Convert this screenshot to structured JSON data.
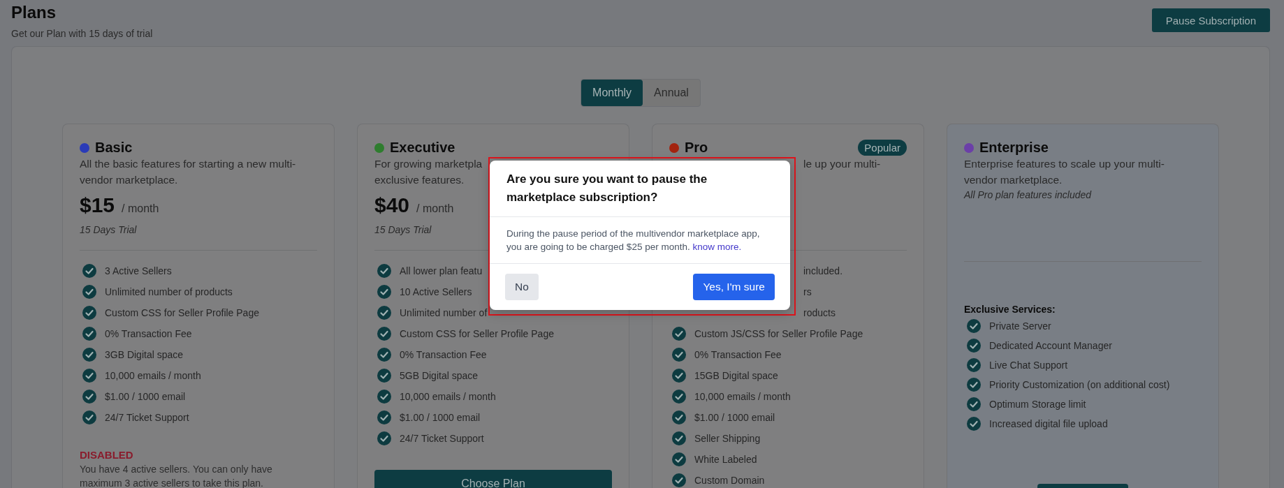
{
  "header": {
    "title": "Plans",
    "subtitle": "Get our Plan with 15 days of trial",
    "pause_button": "Pause Subscription"
  },
  "billing_toggle": [
    {
      "label": "Monthly",
      "selected": true
    },
    {
      "label": "Annual",
      "selected": false
    }
  ],
  "plans": [
    {
      "name": "Basic",
      "color": "#2a3bb8",
      "description_lines": [
        "All the basic features for starting a new multi-",
        "vendor marketplace."
      ],
      "price": "$15",
      "period": "/ month",
      "trial": "15 Days Trial",
      "features": [
        "3 Active Sellers",
        "Unlimited number of products",
        "Custom CSS for Seller Profile Page",
        "0% Transaction Fee",
        "3GB Digital space",
        "10,000 emails / month",
        "$1.00 / 1000 email",
        "24/7 Ticket Support"
      ],
      "notice": {
        "title": "DISABLED",
        "text": "You have 4 active sellers. You can only have maximum 3 active sellers to take this plan."
      }
    },
    {
      "name": "Executive",
      "color": "#2e7d2e",
      "description_lines": [
        "For growing marketpla",
        "exclusive features."
      ],
      "price": "$40",
      "period": "/ month",
      "trial": "15 Days Trial",
      "features": [
        "All lower plan featu",
        "10 Active Sellers",
        "Unlimited number of",
        "Custom CSS for Seller Profile Page",
        "0% Transaction Fee",
        "5GB Digital space",
        "10,000 emails / month",
        "$1.00 / 1000 email",
        "24/7 Ticket Support"
      ],
      "action": "Choose Plan"
    },
    {
      "name": "Pro",
      "color": "#a3230f",
      "badge": "Popular",
      "covered_description": "le up your multi-",
      "covered_features": [
        "included.",
        "rs",
        "roducts"
      ],
      "features": [
        "Custom JS/CSS for Seller Profile Page",
        "0% Transaction Fee",
        "15GB Digital space",
        "10,000 emails / month",
        "$1.00 / 1000 email",
        "Seller Shipping",
        "White Labeled",
        "Custom Domain"
      ]
    },
    {
      "name": "Enterprise",
      "color": "#6b3fa8",
      "tinted": true,
      "description_lines": [
        "Enterprise features to scale up your multi-",
        "vendor marketplace."
      ],
      "note": "All Pro plan features included",
      "section_title": "Exclusive Services:",
      "features": [
        "Private Server",
        "Dedicated Account Manager",
        "Live Chat Support",
        "Priority Customization (on additional cost)",
        "Optimum Storage limit",
        "Increased digital file upload"
      ],
      "cut_button": true
    }
  ],
  "dialog": {
    "title": "Are you sure you want to pause the marketplace subscription?",
    "message": "During the pause period of the multivendor marketplace app, you are going to be charged $25 per month.",
    "link": "know more.",
    "cancel": "No",
    "confirm": "Yes, I'm sure",
    "highlighted": true
  }
}
